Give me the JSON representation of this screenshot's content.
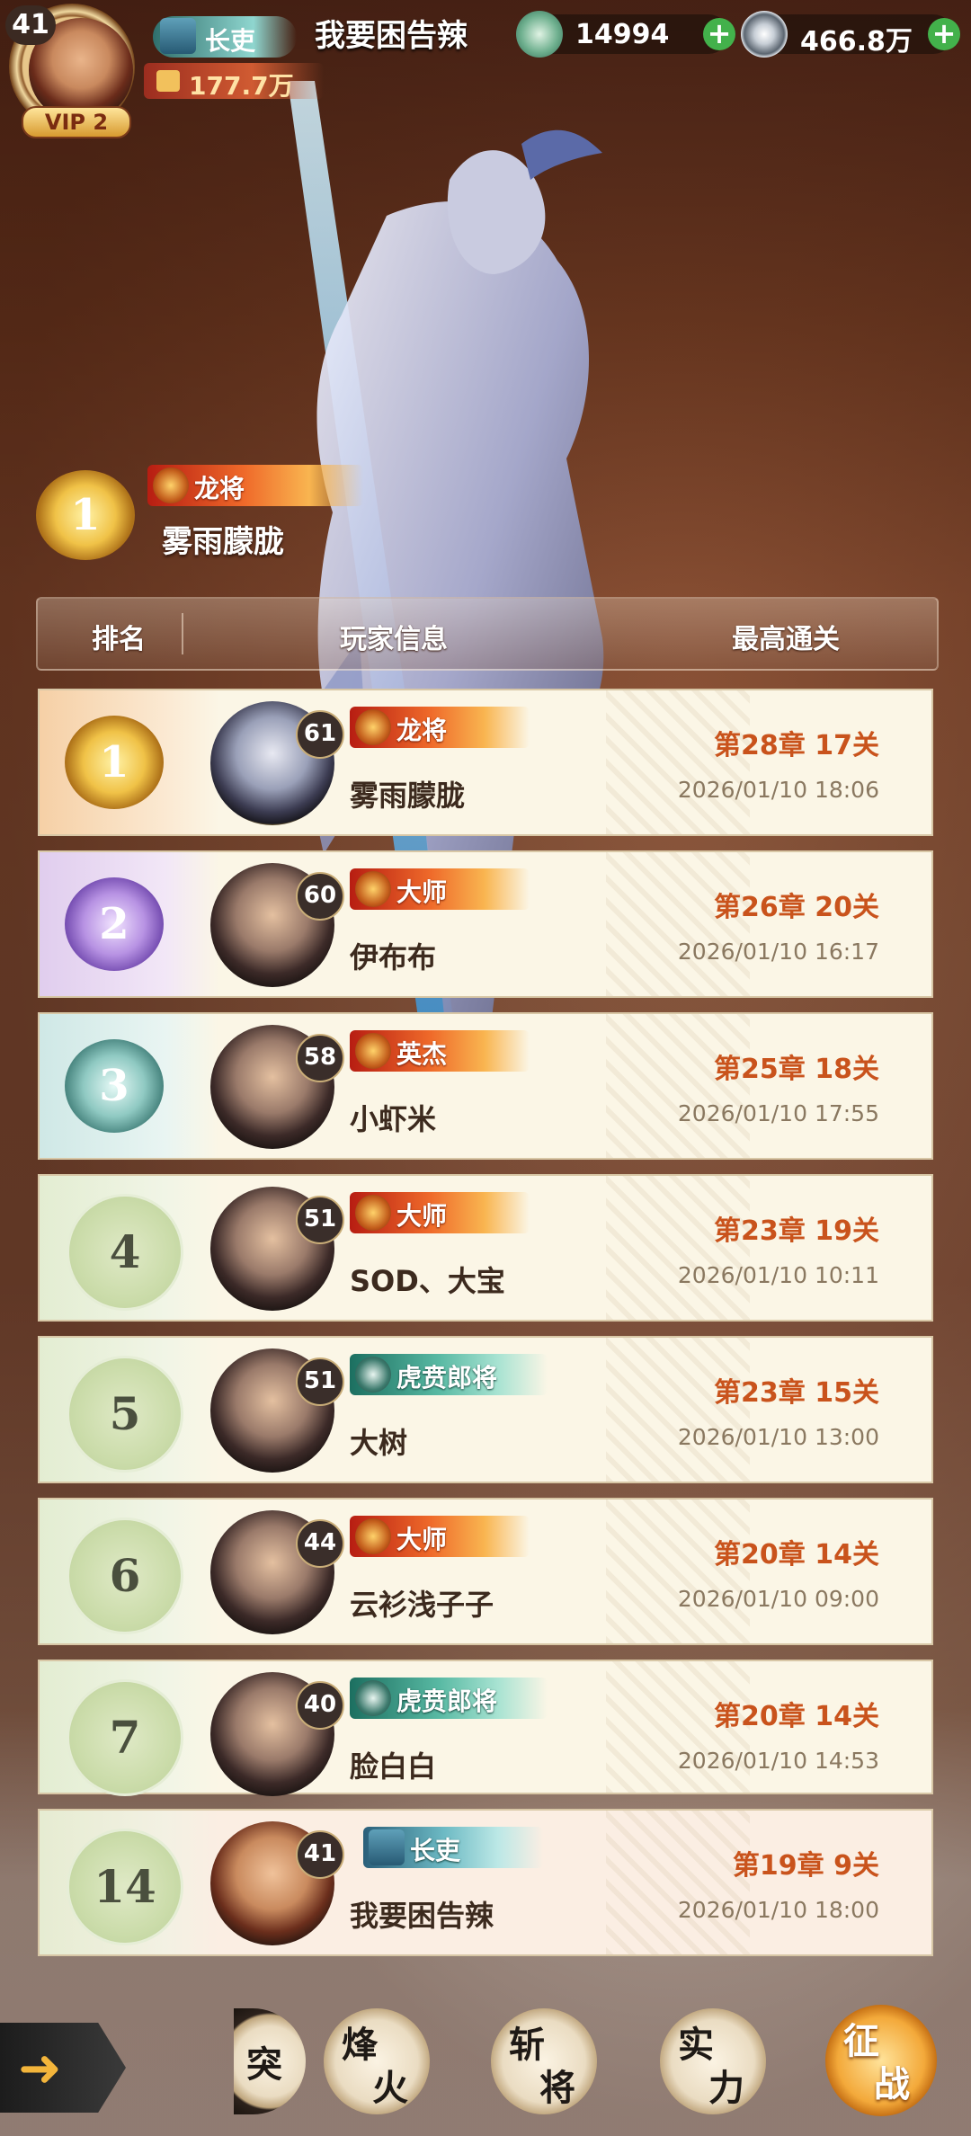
{
  "player": {
    "level": "41",
    "vip": "VIP 2",
    "rank_title": "长吏",
    "name": "我要困告辣",
    "power": "177.7万"
  },
  "resources": {
    "jade": "14994",
    "coins": "466.8万"
  },
  "featured": {
    "rank": "1",
    "title": "龙将",
    "name": "雾雨朦胧"
  },
  "table_header": {
    "rank": "排名",
    "info": "玩家信息",
    "best": "最高通关"
  },
  "rows": [
    {
      "rank": "1",
      "level": "61",
      "title": "龙将",
      "name": "雾雨朦胧",
      "stage": "第28章 17关",
      "date": "2026/01/10 18:06"
    },
    {
      "rank": "2",
      "level": "60",
      "title": "大师",
      "name": "伊布布",
      "stage": "第26章 20关",
      "date": "2026/01/10 16:17"
    },
    {
      "rank": "3",
      "level": "58",
      "title": "英杰",
      "name": "小虾米",
      "stage": "第25章 18关",
      "date": "2026/01/10 17:55"
    },
    {
      "rank": "4",
      "level": "51",
      "title": "大师",
      "name": "SOD、大宝",
      "stage": "第23章 19关",
      "date": "2026/01/10 10:11"
    },
    {
      "rank": "5",
      "level": "51",
      "title": "虎贲郎将",
      "name": "大树",
      "stage": "第23章 15关",
      "date": "2026/01/10 13:00"
    },
    {
      "rank": "6",
      "level": "44",
      "title": "大师",
      "name": "云衫浅子子",
      "stage": "第20章 14关",
      "date": "2026/01/10 09:00"
    },
    {
      "rank": "7",
      "level": "40",
      "title": "虎贲郎将",
      "name": "脸白白",
      "stage": "第20章 14关",
      "date": "2026/01/10 14:53"
    }
  ],
  "self_row": {
    "rank": "14",
    "level": "41",
    "title": "长吏",
    "name": "我要困告辣",
    "stage": "第19章 9关",
    "date": "2026/01/10 18:00"
  },
  "nav": {
    "partial": "突",
    "beacon": [
      "烽",
      "火"
    ],
    "slay": [
      "斩",
      "将"
    ],
    "power": [
      "实",
      "力"
    ],
    "campaign": [
      "征",
      "战"
    ]
  },
  "colors": {
    "stage_text": "#c9531c",
    "date_text": "#8a7860",
    "plus_green": "#43b14b"
  },
  "icons": [
    "jade-coin-icon",
    "silver-coin-icon",
    "plus-icon",
    "fist-icon",
    "back-arrow-icon",
    "dragon-title-icon"
  ]
}
